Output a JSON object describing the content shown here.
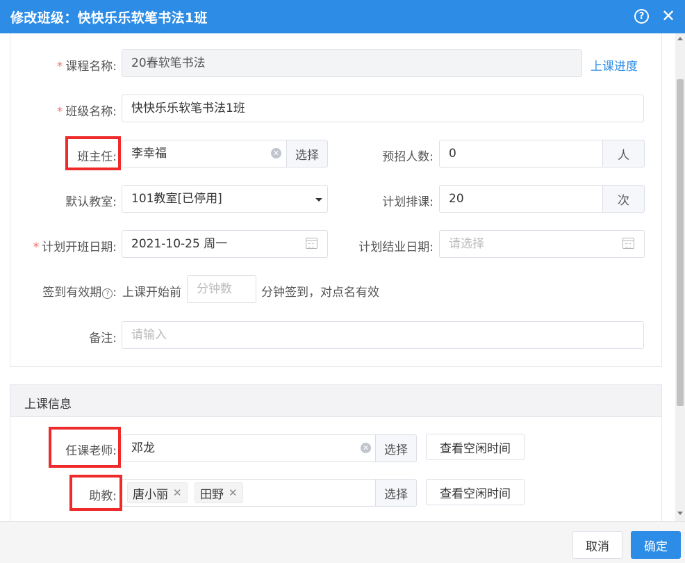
{
  "dialog": {
    "title": "修改班级：快快乐乐软笔书法1班",
    "help_icon": "question-circle-icon",
    "close_icon": "close-icon",
    "help_glyph": "?",
    "close_glyph": "✕"
  },
  "form": {
    "course_name": {
      "label": "课程名称:",
      "value": "20春软笔书法",
      "required_mark": "*",
      "link": "上课进度"
    },
    "class_name": {
      "label": "班级名称:",
      "value": "快快乐乐软笔书法1班",
      "required_mark": "*"
    },
    "head_teacher": {
      "label": "班主任:",
      "value": "李幸福",
      "select_label": "选择"
    },
    "enrollment": {
      "label": "预招人数:",
      "value": "0",
      "unit": "人"
    },
    "classroom": {
      "label": "默认教室:",
      "value": "101教室[已停用]"
    },
    "planned_lessons": {
      "label": "计划排课:",
      "value": "20",
      "unit": "次"
    },
    "start_date": {
      "label": "计划开班日期:",
      "value": "2021-10-25 周一",
      "required_mark": "*"
    },
    "end_date": {
      "label": "计划结业日期:",
      "placeholder": "请选择"
    },
    "checkin": {
      "label": "签到有效期",
      "label_suffix": ":",
      "prefix": "上课开始前",
      "placeholder": "分钟数",
      "suffix": "分钟签到，对点名有效"
    },
    "remark": {
      "label": "备注:",
      "placeholder": "请输入"
    }
  },
  "class_info": {
    "heading": "上课信息",
    "teacher": {
      "label": "任课老师:",
      "value": "邓龙",
      "select_label": "选择",
      "free_time_label": "查看空闲时间"
    },
    "assistant": {
      "label": "助教:",
      "tags": [
        "唐小丽",
        "田野"
      ],
      "select_label": "选择",
      "free_time_label": "查看空闲时间"
    }
  },
  "footer": {
    "cancel": "取消",
    "confirm": "确定"
  },
  "colors": {
    "primary": "#2d8ce6",
    "required": "#f56c6c",
    "highlight": "#ee2a2a"
  }
}
